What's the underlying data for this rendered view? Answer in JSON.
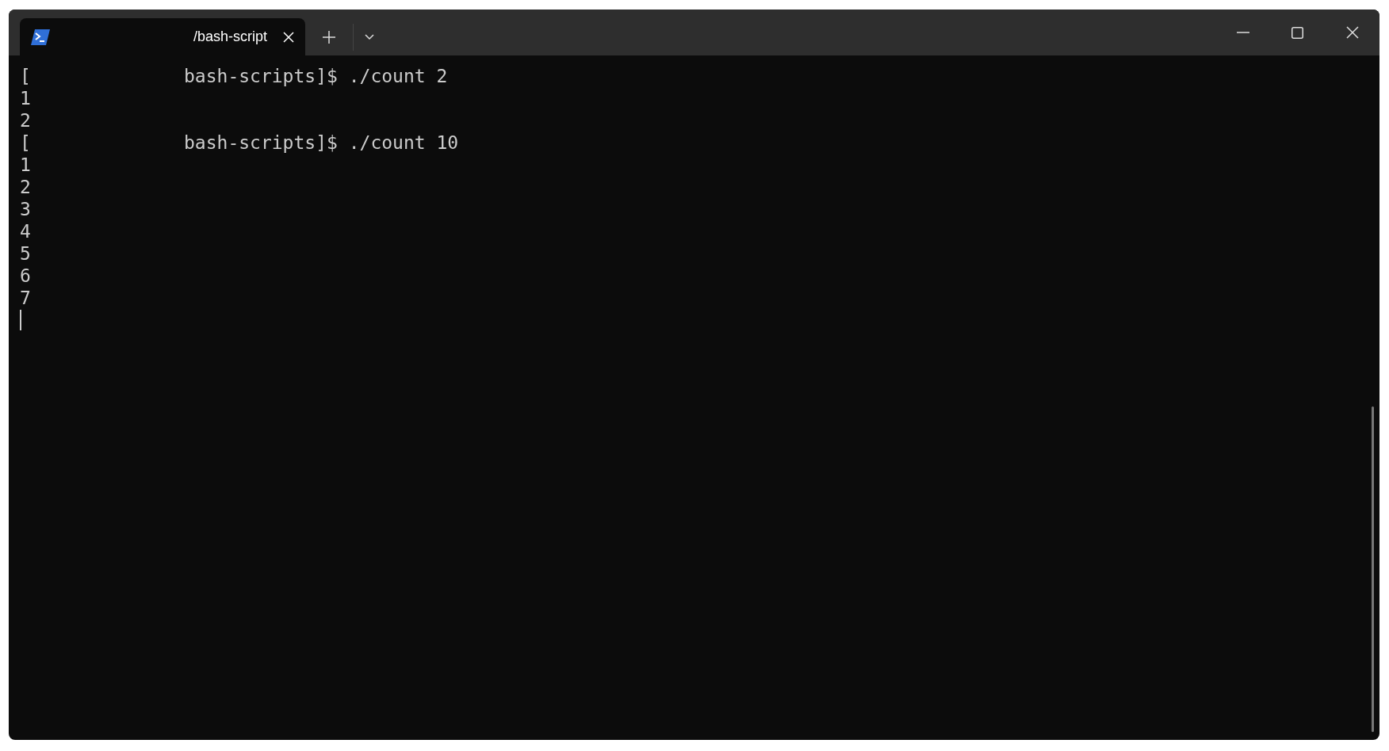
{
  "tabs": [
    {
      "title": "/bash-script",
      "selected": true
    }
  ],
  "terminal": {
    "lines": [
      {
        "kind": "prompt",
        "bracket": "[",
        "command": "bash-scripts]$ ./count 2"
      },
      {
        "kind": "output",
        "text": "1"
      },
      {
        "kind": "output",
        "text": "2"
      },
      {
        "kind": "prompt",
        "bracket": "[",
        "command": "bash-scripts]$ ./count 10"
      },
      {
        "kind": "output",
        "text": "1"
      },
      {
        "kind": "output",
        "text": "2"
      },
      {
        "kind": "output",
        "text": "3"
      },
      {
        "kind": "output",
        "text": "4"
      },
      {
        "kind": "output",
        "text": "5"
      },
      {
        "kind": "output",
        "text": "6"
      },
      {
        "kind": "output",
        "text": "7"
      },
      {
        "kind": "cursor"
      }
    ]
  }
}
